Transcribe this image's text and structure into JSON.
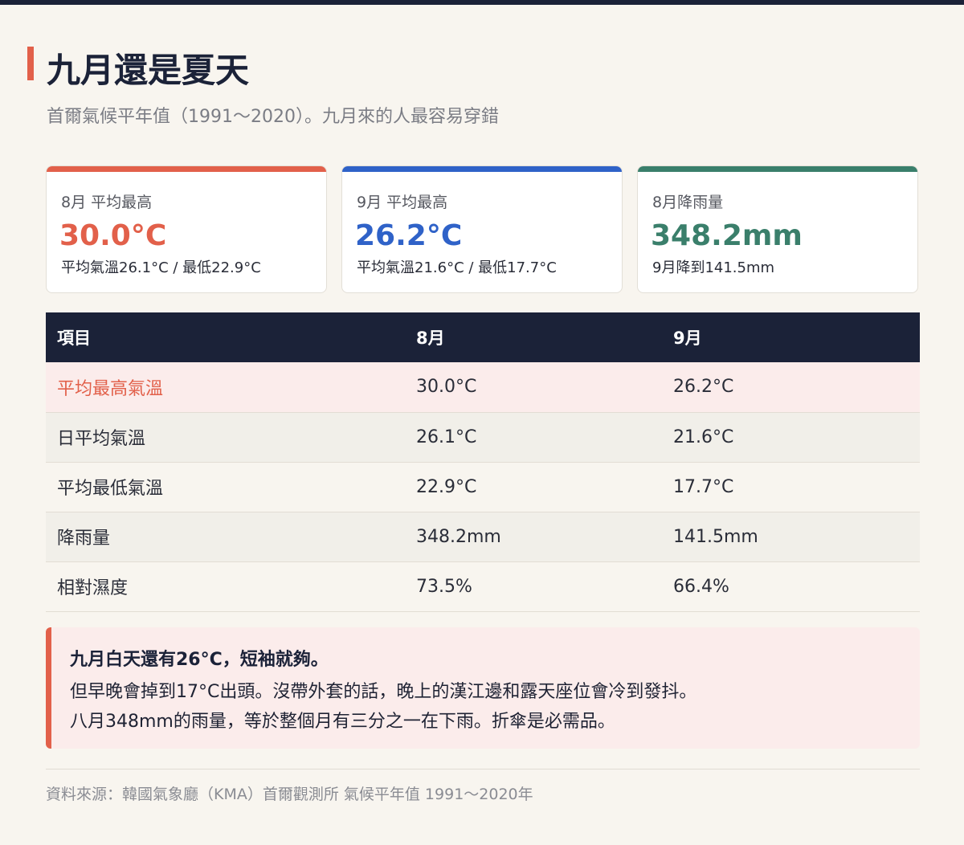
{
  "header": {
    "title": "九月還是夏天",
    "subtitle": "首爾氣候平年值（1991～2020）。九月來的人最容易穿錯"
  },
  "cards": [
    {
      "label": "8月 平均最高",
      "value": "30.0°C",
      "note": "平均氣溫26.1°C / 最低22.9°C",
      "color": "#e2604a"
    },
    {
      "label": "9月 平均最高",
      "value": "26.2°C",
      "note": "平均氣溫21.6°C / 最低17.7°C",
      "color": "#2f62c8"
    },
    {
      "label": "8月降雨量",
      "value": "348.2mm",
      "note": "9月降到141.5mm",
      "color": "#3a7f6b"
    }
  ],
  "table": {
    "headers": [
      "項目",
      "8月",
      "9月"
    ],
    "rows": [
      [
        "平均最高氣溫",
        "30.0°C",
        "26.2°C"
      ],
      [
        "日平均氣溫",
        "26.1°C",
        "21.6°C"
      ],
      [
        "平均最低氣溫",
        "22.9°C",
        "17.7°C"
      ],
      [
        "降雨量",
        "348.2mm",
        "141.5mm"
      ],
      [
        "相對濕度",
        "73.5%",
        "66.4%"
      ]
    ]
  },
  "note": {
    "headline": "九月白天還有26°C，短袖就夠。",
    "line1": "但早晚會掉到17°C出頭。沒帶外套的話，晚上的漢江邊和露天座位會冷到發抖。",
    "line2": "八月348mm的雨量，等於整個月有三分之一在下雨。折傘是必需品。"
  },
  "footer": {
    "source": "資料來源：韓國氣象廳（KMA）首爾觀測所 氣候平年值 1991～2020年"
  },
  "colors": {
    "navy": "#1b2238",
    "accent_red": "#e2604a",
    "accent_blue": "#2f62c8",
    "accent_green": "#3a7f6b",
    "highlight_row": "#fbeceb"
  }
}
